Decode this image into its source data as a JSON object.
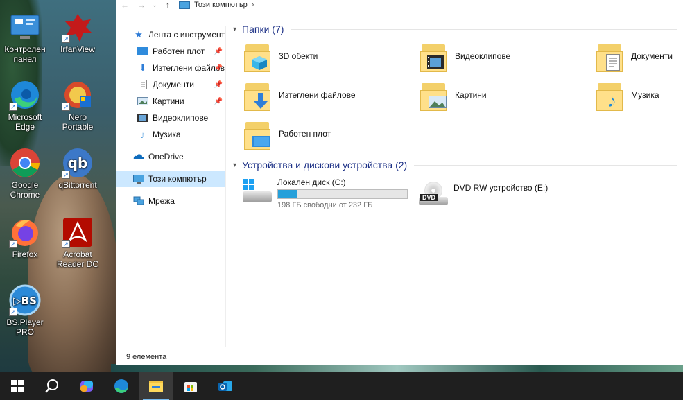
{
  "desktop": {
    "icons": [
      {
        "label": "Контролен панел",
        "icon": "control-panel-icon"
      },
      {
        "label": "IrfanView",
        "icon": "irfanview-icon"
      },
      {
        "label": "Microsoft Edge",
        "icon": "edge-icon"
      },
      {
        "label": "Nero Portable",
        "icon": "nero-icon"
      },
      {
        "label": "Google Chrome",
        "icon": "chrome-icon"
      },
      {
        "label": "qBittorrent",
        "icon": "qbittorrent-icon"
      },
      {
        "label": "Firefox",
        "icon": "firefox-icon"
      },
      {
        "label": "Acrobat Reader DC",
        "icon": "acrobat-icon"
      },
      {
        "label": "BS.Player PRO",
        "icon": "bsplayer-icon"
      }
    ]
  },
  "explorer": {
    "address": {
      "location": "Този компютър"
    },
    "nav": {
      "quick_access": "Лента с инструменти за бърз достъп",
      "pinned": [
        {
          "label": "Работен плот",
          "icon": "desktop-icon"
        },
        {
          "label": "Изтеглени файлове",
          "icon": "downloads-icon"
        },
        {
          "label": "Документи",
          "icon": "documents-icon"
        },
        {
          "label": "Картини",
          "icon": "pictures-icon"
        }
      ],
      "recent": [
        {
          "label": "Видеоклипове",
          "icon": "videos-icon"
        },
        {
          "label": "Музика",
          "icon": "music-icon"
        }
      ],
      "onedrive": "OneDrive",
      "this_pc": "Този компютър",
      "network": "Мрежа"
    },
    "folders_header": "Папки (7)",
    "folders": [
      {
        "label": "3D обекти",
        "icon": "3d-objects-icon"
      },
      {
        "label": "Видеоклипове",
        "icon": "videos-icon"
      },
      {
        "label": "Документи",
        "icon": "documents-icon"
      },
      {
        "label": "Изтеглени файлове",
        "icon": "downloads-icon"
      },
      {
        "label": "Картини",
        "icon": "pictures-icon"
      },
      {
        "label": "Музика",
        "icon": "music-icon"
      },
      {
        "label": "Работен плот",
        "icon": "desktop-icon"
      }
    ],
    "devices_header": "Устройства и дискови устройства (2)",
    "drives": [
      {
        "label": "Локален диск (C:)",
        "free_text": "198 ГБ свободни от 232 ГБ",
        "used_fraction": 0.147
      },
      {
        "label": "DVD RW устройство (E:)",
        "dvd_badge": "DVD"
      }
    ],
    "status": "9 елемента"
  },
  "taskbar": {
    "items": [
      "start-icon",
      "search-icon",
      "copilot-icon",
      "edge-icon",
      "file-explorer-icon",
      "store-icon",
      "outlook-icon"
    ],
    "active": "file-explorer-icon"
  },
  "colors": {
    "accent": "#26a0da",
    "header": "#1e3287",
    "selection": "#cce8ff",
    "taskbar": "#1f1f1f"
  }
}
